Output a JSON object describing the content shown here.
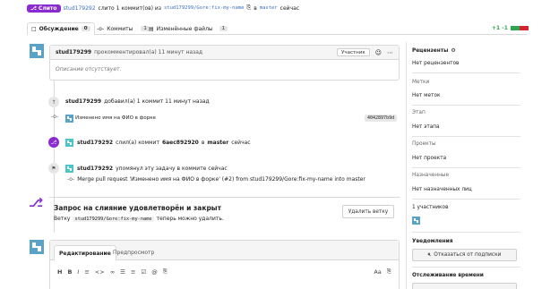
{
  "header": {
    "status_badge": "Слито",
    "author": "stud179292",
    "merged_text": "слито 1 коммит(ов) из",
    "source_branch": "stud179299/Gore:fix-my-name",
    "into_text": "в",
    "target_branch": "master",
    "time_text": "сейчас",
    "diff_stats": "+1 -1"
  },
  "tabs": [
    {
      "label": "Обсуждение",
      "count": "0"
    },
    {
      "label": "Коммиты",
      "count": "1"
    },
    {
      "label": "Изменённые файлы",
      "count": "1"
    }
  ],
  "first_comment": {
    "author": "stud179299",
    "action": "прокомментировал(а) 11 минут назад",
    "role_label": "Участник",
    "body_placeholder": "Описание отсутствует."
  },
  "timeline": {
    "added_commit": {
      "author": "stud179299",
      "text": "добавил(а) 1 коммит 11 минут назад"
    },
    "commit_row": {
      "message": "Изменено имя на ФИО в форке",
      "sha": "4042897b9d"
    },
    "merged_event": {
      "author": "stud179292",
      "text_1": "слил(а) коммит",
      "sha": "6aec892920",
      "text_2": "в",
      "branch": "master",
      "text_3": "сейчас"
    },
    "mentioned_event": {
      "author": "stud179292",
      "text": "упомянул эту задачу в коммите сейчас",
      "commit_message": "Merge pull request 'Изменено имя на ФИО в форке' (#2) from stud179299/Gore:fix-my-name into master"
    }
  },
  "merge_box": {
    "title": "Запрос на слияние удовлетворён и закрыт",
    "branch_prefix": "Ветку",
    "branch_name": "stud179299/Gore:fix-my-name",
    "branch_suffix": "теперь можно удалить.",
    "delete_button": "Удалить ветку"
  },
  "editor": {
    "tab_edit": "Редактирование",
    "tab_preview": "Предпросмотр",
    "toolbar": [
      "H",
      "B",
      "I",
      "≡",
      "<>",
      "🔗",
      "☰",
      "≡",
      "☑",
      "@",
      "⎘"
    ],
    "font_toggle": "Aa"
  },
  "sidebar": {
    "reviewers_label": "Рецензенты",
    "reviewers_value": "Нет рецензентов",
    "labels_label": "Метки",
    "labels_value": "Нет меток",
    "milestone_label": "Этап",
    "milestone_value": "Нет этапа",
    "projects_label": "Проекты",
    "projects_value": "Нет проекта",
    "assignees_label": "Назначенные",
    "assignees_value": "Нет назначенных лиц",
    "participants_label": "1 участников",
    "notifications_label": "Уведомления",
    "unsubscribe_button": "Отказаться от подписки",
    "time_tracking_label": "Отслеживание времени"
  },
  "colors": {
    "merged_purple": "#8a2bd1",
    "link_blue": "#3b6fc4",
    "add_green": "#2da44e",
    "del_red": "#d1242f"
  }
}
